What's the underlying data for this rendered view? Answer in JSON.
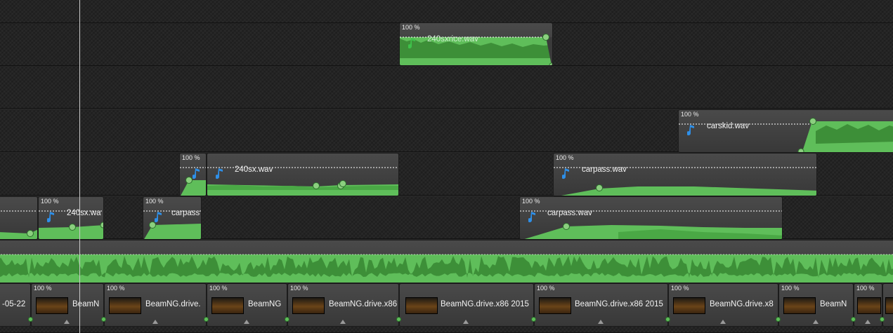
{
  "tracks": {
    "track1": {
      "clips": [
        {
          "name": "240sxrice.wav",
          "volume": "100 %",
          "icon": "music-note-icon"
        }
      ]
    },
    "track2": {
      "clips": [
        {
          "name": "carskid.wav",
          "volume": "100 %",
          "icon": "music-note-icon"
        }
      ]
    },
    "track3": {
      "clips": [
        {
          "name": "",
          "volume": "100 %",
          "icon": "music-note-icon"
        },
        {
          "name": "240sx.wav",
          "volume": "",
          "icon": "music-note-icon"
        },
        {
          "name": "carpass.wav",
          "volume": "100 %",
          "icon": "music-note-icon"
        }
      ]
    },
    "track4": {
      "clips": [
        {
          "name": "240sx.wa",
          "volume": "100 %",
          "icon": "music-note-icon"
        },
        {
          "name": "carpass",
          "volume": "100 %",
          "icon": "music-note-icon"
        },
        {
          "name": "carpass.wav",
          "volume": "100 %",
          "icon": "music-note-icon"
        }
      ]
    }
  },
  "video_track": {
    "clips": [
      {
        "label": "-05-22",
        "volume": ""
      },
      {
        "label": "BeamN",
        "volume": "100 %"
      },
      {
        "label": "BeamNG.drive.",
        "volume": "100 %"
      },
      {
        "label": "BeamNG",
        "volume": "100 %"
      },
      {
        "label": "BeamNG.drive.x86",
        "volume": "100 %"
      },
      {
        "label": "BeamNG.drive.x86 2015",
        "volume": ""
      },
      {
        "label": "BeamNG.drive.x86 2015",
        "volume": "100 %"
      },
      {
        "label": "BeamNG.drive.x8",
        "volume": "100 %"
      },
      {
        "label": "BeamN",
        "volume": "100 %"
      },
      {
        "label": "",
        "volume": "100 %"
      }
    ]
  },
  "colors": {
    "waveform": "#5fbe5a",
    "waveform_dark": "#3d8f38",
    "music_note_green": "#3ec24a",
    "music_note_blue": "#2e8fe8",
    "playhead": "#c9c9c9"
  }
}
